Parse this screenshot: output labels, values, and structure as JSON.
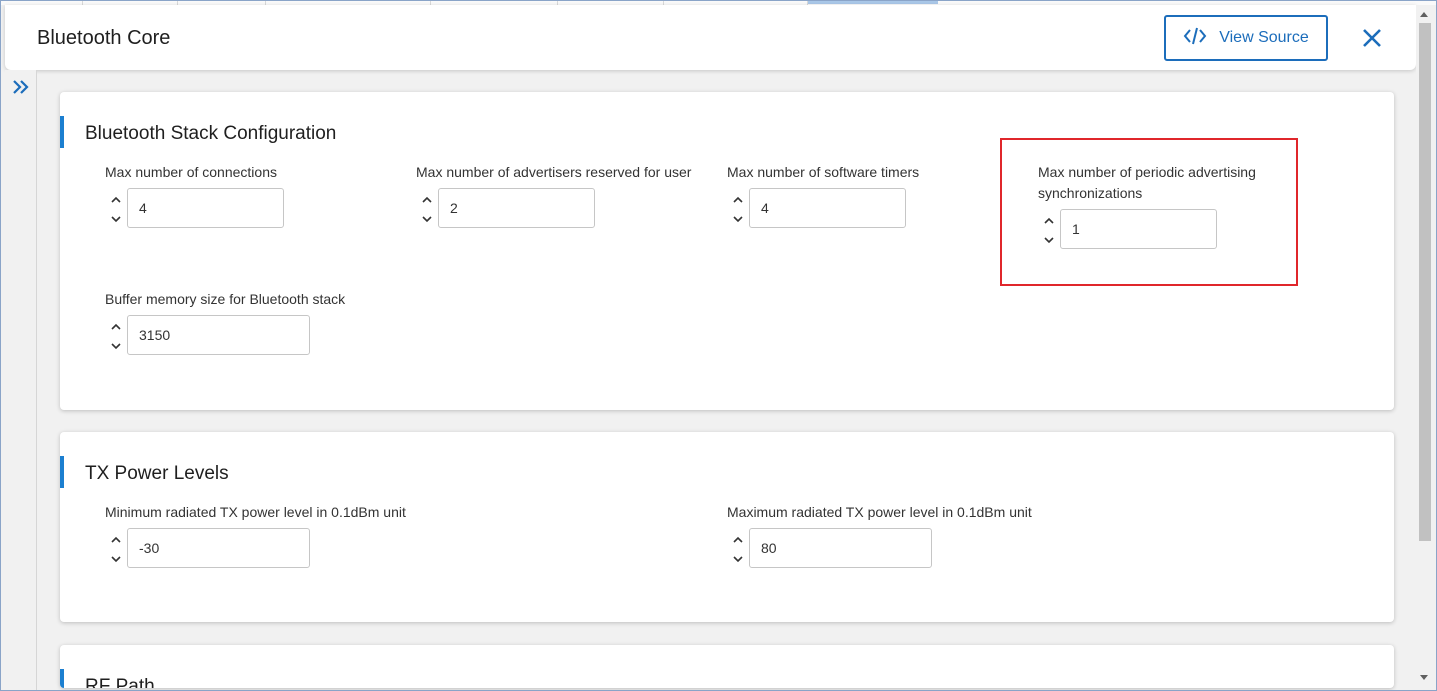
{
  "header": {
    "title": "Bluetooth Core",
    "view_source_label": "View Source"
  },
  "icons": {
    "view_source": "code-icon",
    "close": "close-icon",
    "sidebar_toggle": "double-chevron-right-icon",
    "increment": "chevron-up-icon",
    "decrement": "chevron-down-icon"
  },
  "colors": {
    "accent": "#1c6dbb",
    "section_bar": "#1c7fd0",
    "highlight": "#e0262b"
  },
  "sections": [
    {
      "title": "Bluetooth Stack Configuration",
      "fields": [
        {
          "label": "Max number of connections",
          "value": "4"
        },
        {
          "label": "Max number of advertisers reserved for user",
          "value": "2"
        },
        {
          "label": "Max number of software timers",
          "value": "4"
        },
        {
          "label_line1": "Max number of periodic advertising",
          "label_line2": "synchronizations",
          "value": "1"
        },
        {
          "label": "Buffer memory size for Bluetooth stack",
          "value": "3150"
        }
      ]
    },
    {
      "title": "TX Power Levels",
      "fields": [
        {
          "label": "Minimum radiated TX power level in 0.1dBm unit",
          "value": "-30"
        },
        {
          "label": "Maximum radiated TX power level in 0.1dBm unit",
          "value": "80"
        }
      ]
    },
    {
      "title": "RF Path"
    }
  ]
}
